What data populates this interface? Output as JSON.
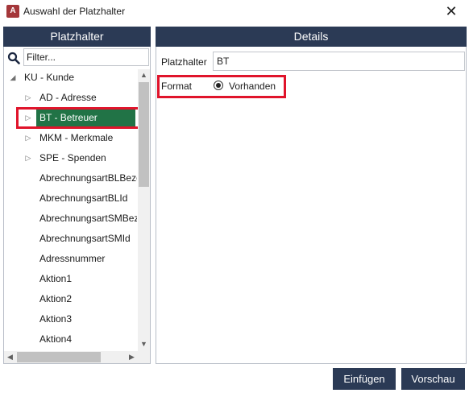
{
  "window": {
    "title": "Auswahl der Platzhalter",
    "close_symbol": "✕",
    "app_icon_text": "A"
  },
  "left_panel": {
    "header": "Platzhalter",
    "filter_placeholder": "Filter...",
    "tree": [
      {
        "label": "KU - Kunde",
        "arrow": "◢",
        "expanded": true,
        "level": 0
      },
      {
        "label": "AD - Adresse",
        "arrow": "▷",
        "level": 1
      },
      {
        "label": "BT - Betreuer",
        "arrow": "▷",
        "level": 1,
        "selected": true
      },
      {
        "label": "MKM - Merkmale",
        "arrow": "▷",
        "level": 1
      },
      {
        "label": "SPE - Spenden",
        "arrow": "▷",
        "level": 1
      },
      {
        "label": "AbrechnungsartBLBezeichnung",
        "level": 1
      },
      {
        "label": "AbrechnungsartBLId",
        "level": 1
      },
      {
        "label": "AbrechnungsartSMBezeichnung",
        "level": 1
      },
      {
        "label": "AbrechnungsartSMId",
        "level": 1
      },
      {
        "label": "Adressnummer",
        "level": 1
      },
      {
        "label": "Aktion1",
        "level": 1
      },
      {
        "label": "Aktion2",
        "level": 1
      },
      {
        "label": "Aktion3",
        "level": 1
      },
      {
        "label": "Aktion4",
        "level": 1
      }
    ],
    "scroll_up": "▲",
    "scroll_down": "▼",
    "scroll_left": "◀",
    "scroll_right": "▶"
  },
  "details": {
    "header": "Details",
    "placeholder_label": "Platzhalter",
    "placeholder_value": "BT",
    "format_label": "Format",
    "format_option": "Vorhanden",
    "format_selected": true
  },
  "buttons": {
    "insert": "Einfügen",
    "preview": "Vorschau"
  },
  "colors": {
    "header_bg": "#2b3a55",
    "selection_bg": "#217346",
    "highlight_border": "#e0142b"
  }
}
